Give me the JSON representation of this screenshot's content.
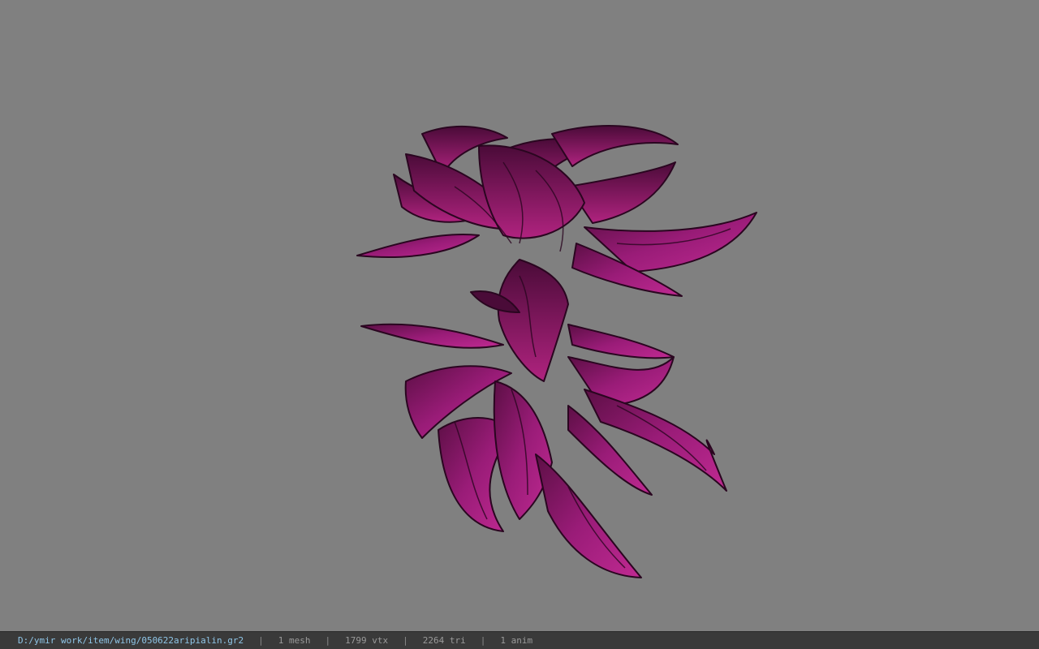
{
  "status_bar": {
    "file_path": "D:/ymir work/item/wing/050622aripialin.gr2",
    "separator": "|",
    "mesh_count": "1 mesh",
    "vertex_count": "1799 vtx",
    "triangle_count": "2264 tri",
    "anim_count": "1 anim"
  },
  "colors": {
    "viewport_background": "#808080",
    "model_primary": "#a01a7a",
    "model_dark": "#3a0a2c",
    "status_bar_background": "#3a3a3a",
    "path_text": "#8fc6e8"
  }
}
